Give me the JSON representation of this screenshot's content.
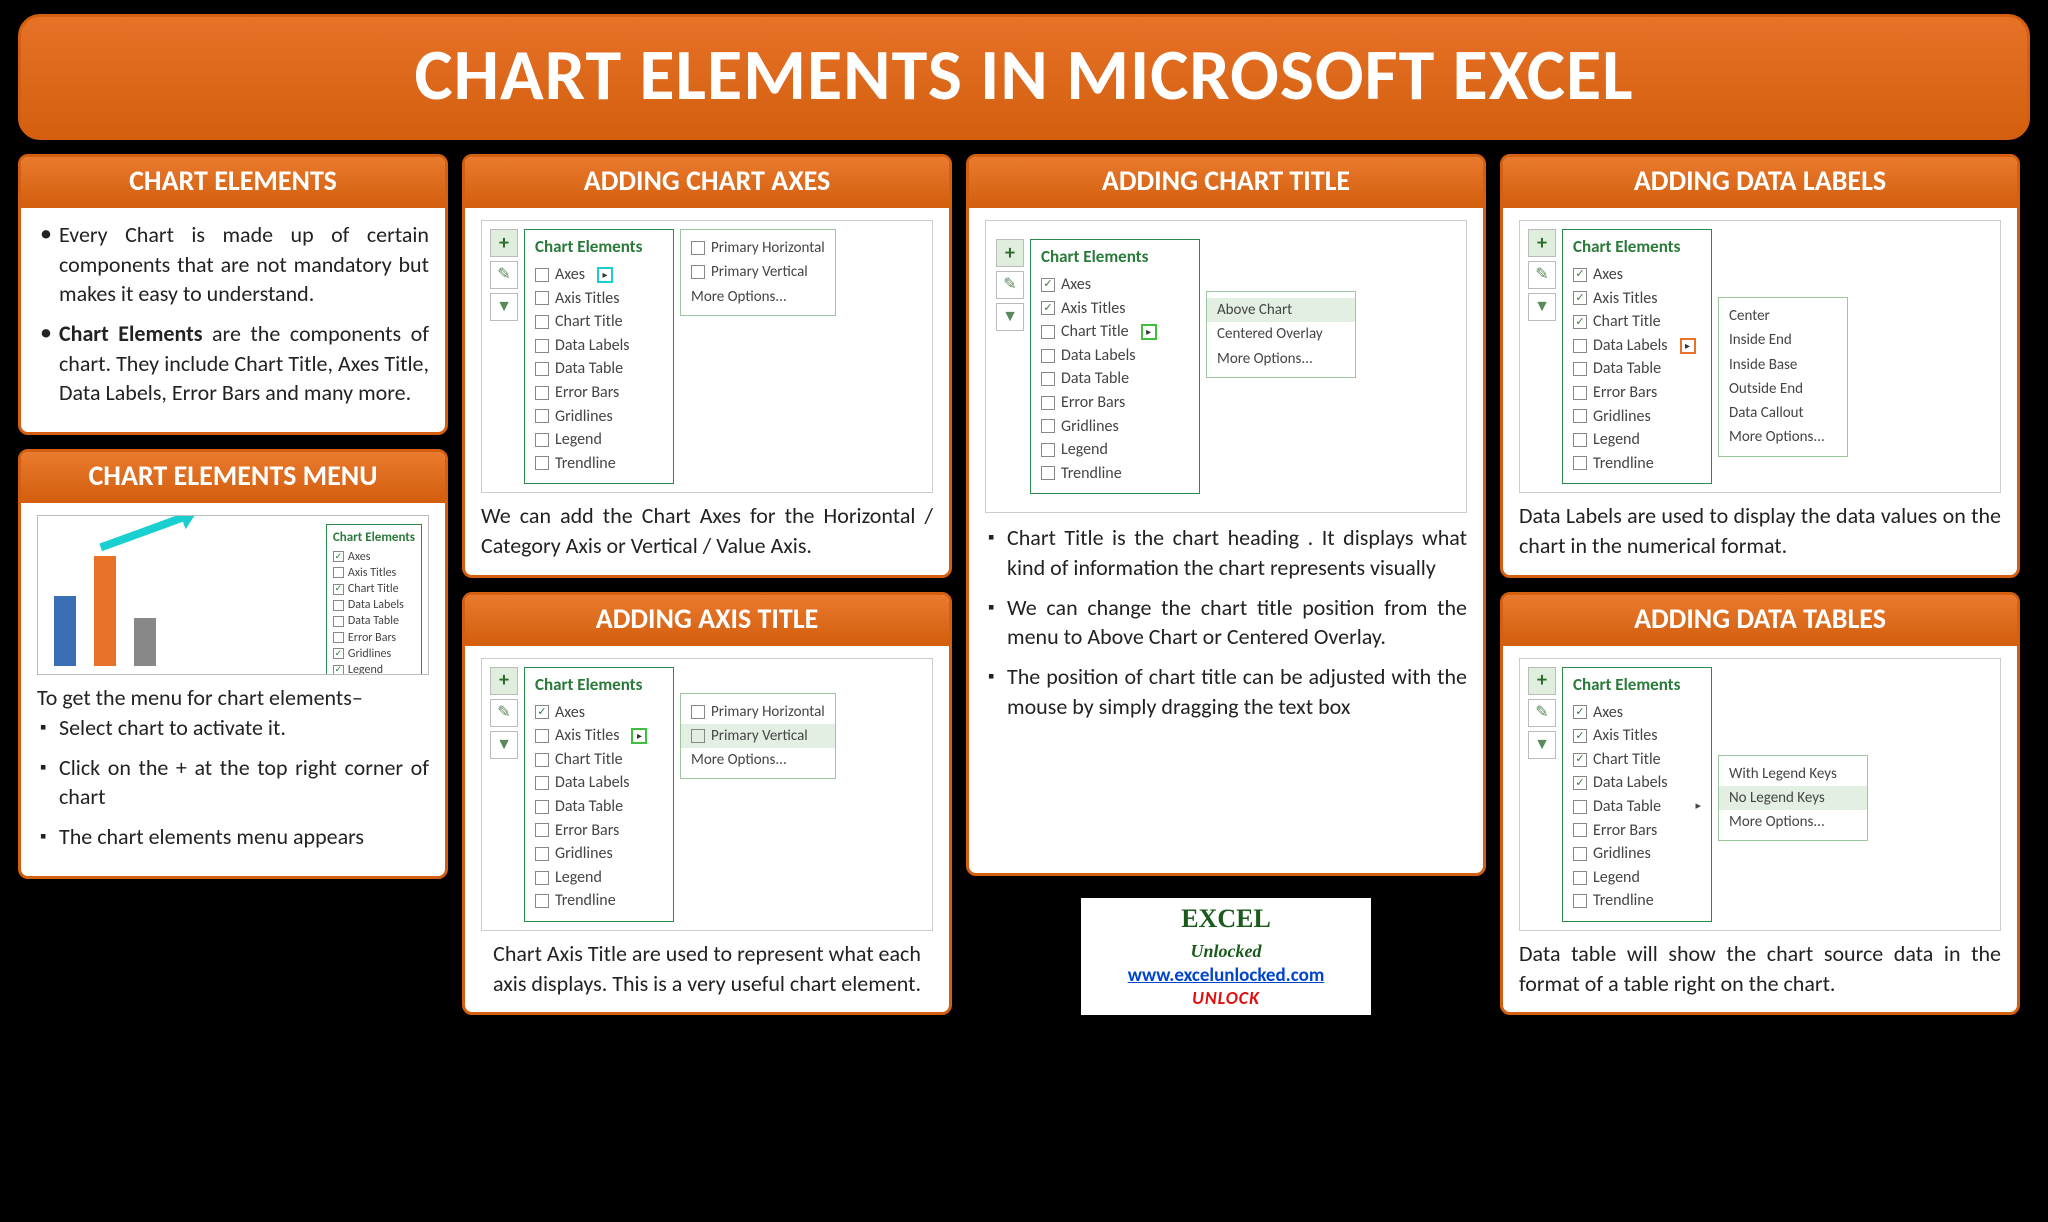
{
  "title": "CHART ELEMENTS IN MICROSOFT EXCEL",
  "chartElements": {
    "header": "CHART ELEMENTS",
    "b1a": "Every Chart is made up of certain components that are not mandatory but makes it easy to understand.",
    "b2a": "Chart Elements",
    "b2b": " are the components of chart. They include Chart Title, Axes Title, Data Labels, Error Bars and many more."
  },
  "menu": {
    "header": "CHART ELEMENTS MENU",
    "intro": "To get the menu for chart elements–",
    "s1": "Select chart to activate it.",
    "s2": "Click on the + at the top right corner of chart",
    "s3": "The chart elements menu appears"
  },
  "axes": {
    "header": "ADDING CHART AXES",
    "caption": "We can add the Chart Axes for the Horizontal / Category Axis or Vertical / Value Axis."
  },
  "axisTitle": {
    "header": "ADDING AXIS TITLE",
    "caption": "Chart Axis Title are used to represent what each axis displays. This is a very useful chart element."
  },
  "chartTitle": {
    "header": "ADDING CHART TITLE",
    "b1": "Chart Title is the chart heading . It displays what kind of information the chart represents visually",
    "b2": "We can change the chart title position from the menu to Above Chart or Centered Overlay.",
    "b3": "The position of chart title can be adjusted with the mouse by simply dragging the text box"
  },
  "dataLabels": {
    "header": "ADDING DATA LABELS",
    "caption": "Data Labels are used to display the data values on the chart in the numerical format."
  },
  "dataTables": {
    "header": "ADDING DATA TABLES",
    "caption": "Data table will show the chart source data in the format of a table right on the chart."
  },
  "ce": {
    "title": "Chart Elements",
    "items": [
      "Axes",
      "Axis Titles",
      "Chart Title",
      "Data Labels",
      "Data Table",
      "Error Bars",
      "Gridlines",
      "Legend",
      "Trendline"
    ]
  },
  "sub_axes": [
    "Primary Horizontal",
    "Primary Vertical",
    "More Options..."
  ],
  "sub_title": [
    "Above Chart",
    "Centered Overlay",
    "More Options..."
  ],
  "sub_labels": [
    "Center",
    "Inside End",
    "Inside Base",
    "Outside End",
    "Data Callout",
    "More Options..."
  ],
  "sub_tables": [
    "With Legend Keys",
    "No Legend Keys",
    "More Options..."
  ],
  "brand": {
    "name1": "EXCEL",
    "name2": "Unlocked",
    "url": "www.excelunlocked.com",
    "tag": "UNLOCK"
  }
}
